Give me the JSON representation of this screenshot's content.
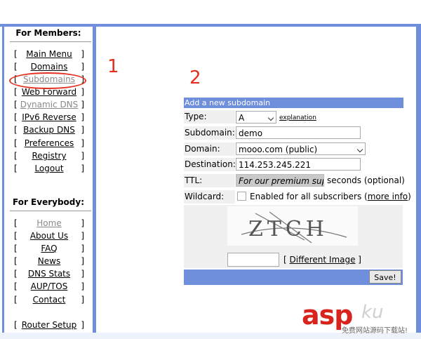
{
  "sidebar": {
    "members_heading": "For Members:",
    "members_items": [
      {
        "label": "Main Menu"
      },
      {
        "label": "Domains"
      },
      {
        "label": "Subdomains"
      },
      {
        "label": "Web Forward"
      },
      {
        "label": "Dynamic DNS"
      },
      {
        "label": "IPv6 Reverse"
      },
      {
        "label": "Backup DNS"
      },
      {
        "label": "Preferences"
      },
      {
        "label": "Registry"
      },
      {
        "label": "Logout"
      }
    ],
    "everybody_heading": "For Everybody:",
    "everybody_items": [
      {
        "label": "Home"
      },
      {
        "label": "About Us"
      },
      {
        "label": "FAQ"
      },
      {
        "label": "News"
      },
      {
        "label": "DNS Stats"
      },
      {
        "label": "AUP/TOS"
      },
      {
        "label": "Contact"
      },
      {
        "label": "Router Setup"
      }
    ]
  },
  "annotations": {
    "step1": "1",
    "step2": "2"
  },
  "form": {
    "title": "Add a new subdomain",
    "type_label": "Type:",
    "type_value": "A",
    "explanation_link": "explanation",
    "subdomain_label": "Subdomain:",
    "subdomain_value": "demo",
    "domain_label": "Domain:",
    "domain_value": "mooo.com (public)",
    "destination_label": "Destination:",
    "destination_value": "114.253.245.221",
    "ttl_label": "TTL:",
    "ttl_placeholder": "For our premium suppor",
    "ttl_suffix": "seconds (optional)",
    "wildcard_label": "Wildcard:",
    "wildcard_text": "Enabled for all subscribers",
    "more_info_link": "more info",
    "captcha_text": "ZTCH",
    "different_image_link": "Different Image",
    "save_label": "Save!"
  },
  "watermark": {
    "brand": "asp",
    "brand2": "ku",
    "tagline": "免费网站源码下载站!"
  },
  "colors": {
    "frame": "#6f8fdc",
    "annotation": "#e0301e",
    "form_bg": "#f0f0f0"
  }
}
